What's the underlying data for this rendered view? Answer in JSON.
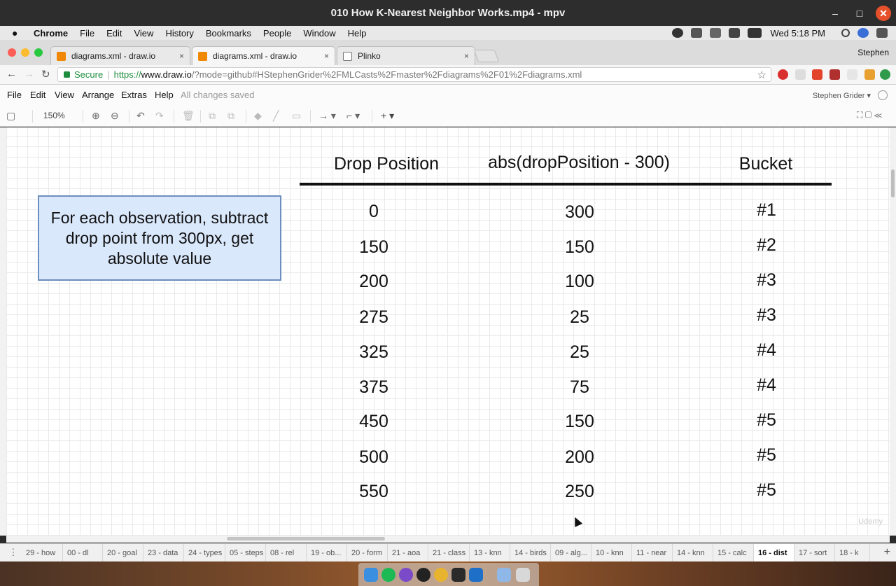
{
  "window": {
    "title": "010 How K-Nearest Neighbor Works.mp4 - mpv",
    "minimize": "–",
    "maximize": "□",
    "close": "✕"
  },
  "menubar": {
    "apple": "",
    "items": [
      "Chrome",
      "File",
      "Edit",
      "View",
      "History",
      "Bookmarks",
      "People",
      "Window",
      "Help"
    ],
    "clock": "Wed 5:18 PM"
  },
  "browser": {
    "tabs": [
      {
        "title": "diagrams.xml - draw.io",
        "close": "×"
      },
      {
        "title": "diagrams.xml - draw.io",
        "close": "×"
      },
      {
        "title": "Plinko",
        "close": "×"
      }
    ],
    "profile": "Stephen",
    "secure_label": "Secure",
    "url_scheme": "https://",
    "url_host": "www.draw.io",
    "url_rest": "/?mode=github#HStephenGrider%2FMLCasts%2Fmaster%2Fdiagrams%2F01%2Fdiagrams.xml",
    "back": "←",
    "forward": "→",
    "reload": "↻",
    "star": "☆"
  },
  "drawio": {
    "menu": [
      "File",
      "Edit",
      "View",
      "Arrange",
      "Extras",
      "Help"
    ],
    "saved_status": "All changes saved",
    "user": "Stephen Grider ▾",
    "zoom": "150%",
    "toolbar_icons": {
      "format": "▢",
      "zoom_in": "⊕",
      "zoom_out": "⊖",
      "undo": "↶",
      "redo": "↷",
      "delete": "🗑",
      "to_front": "⧉",
      "to_back": "⧉",
      "fill": "◆",
      "line": "╱",
      "shadow": "▭",
      "connection": "→ ▾",
      "waypoints": "⌐ ▾",
      "insert": "+ ▾",
      "fullscreen": "⛶ ▢ ≪"
    }
  },
  "diagram": {
    "note": "For each observation, subtract drop point from 300px, get absolute value",
    "headers": [
      "Drop Position",
      "abs(dropPosition - 300)",
      "Bucket"
    ],
    "rows": [
      {
        "drop": "0",
        "abs": "300",
        "bucket": "#1"
      },
      {
        "drop": "150",
        "abs": "150",
        "bucket": "#2"
      },
      {
        "drop": "200",
        "abs": "100",
        "bucket": "#3"
      },
      {
        "drop": "275",
        "abs": "25",
        "bucket": "#3"
      },
      {
        "drop": "325",
        "abs": "25",
        "bucket": "#4"
      },
      {
        "drop": "375",
        "abs": "75",
        "bucket": "#4"
      },
      {
        "drop": "450",
        "abs": "150",
        "bucket": "#5"
      },
      {
        "drop": "500",
        "abs": "200",
        "bucket": "#5"
      },
      {
        "drop": "550",
        "abs": "250",
        "bucket": "#5"
      }
    ],
    "watermark": "Udemy"
  },
  "pages": {
    "menu": "⋮",
    "add": "+",
    "tabs": [
      "29 - how",
      "00 - dl",
      "20 - goal",
      "23 - data",
      "24 - types",
      "05 - steps",
      "08 - rel",
      "19 - ob...",
      "20 - form",
      "21 - aoa",
      "21 - class",
      "13 - knn",
      "14 - birds",
      "09 - alg...",
      "10 - knn",
      "11 - near",
      "14 - knn",
      "15 - calc",
      "16 - dist",
      "17 - sort",
      "18 - k"
    ],
    "active": "16 - dist"
  },
  "colors": {
    "note_fill": "#dae8fc",
    "note_stroke": "#6c8ebf",
    "secure_green": "#1e8e3e",
    "mpv_close": "#e6502a"
  }
}
